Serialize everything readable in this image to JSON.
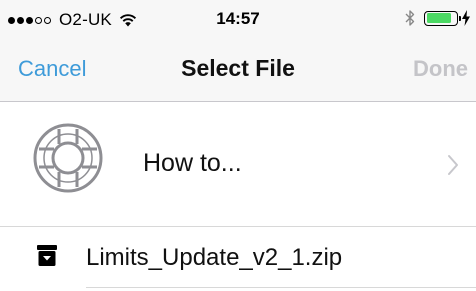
{
  "status_bar": {
    "signal_bars_filled": 3,
    "signal_bars_total": 5,
    "carrier": "O2-UK",
    "time": "14:57",
    "battery_level": 0.85,
    "battery_color": "#4cd964",
    "icons": [
      "wifi-icon",
      "bluetooth-icon",
      "battery-icon",
      "charging-bolt-icon"
    ]
  },
  "nav_bar": {
    "cancel_label": "Cancel",
    "title": "Select File",
    "done_label": "Done",
    "cancel_color": "#3e9bd9",
    "done_color": "#c4c4c8"
  },
  "list": {
    "howto": {
      "label": "How to...",
      "icon": "lifebuoy-icon",
      "accessory": "chevron-right-icon"
    },
    "files": [
      {
        "name": "Limits_Update_v2_1.zip",
        "icon": "archive-icon"
      }
    ]
  }
}
